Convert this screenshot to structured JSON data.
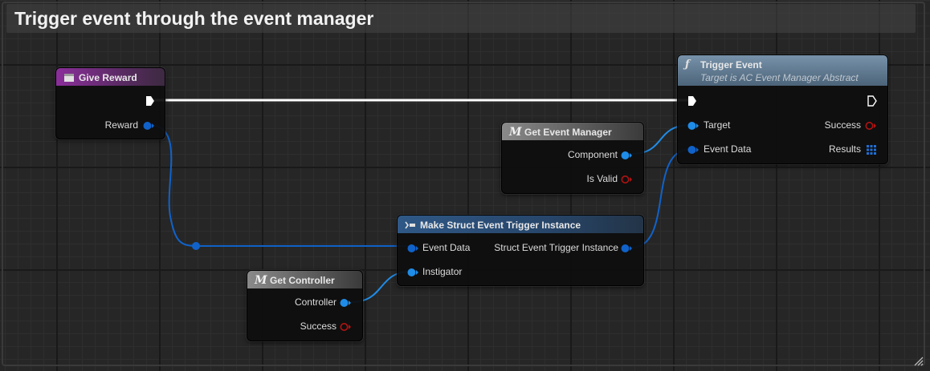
{
  "comment": {
    "title": "Trigger event through the event manager"
  },
  "colors": {
    "exec_wire": "#ffffff",
    "object_pin": "#1f8ce8",
    "struct_pin": "#1062c9",
    "bool_pin": "#b31313",
    "event_header": "#8a2f9a",
    "function_header": "#6d8aa3",
    "macro_header": "#7a7a7a",
    "struct_header": "#2a4f78"
  },
  "nodes": {
    "give_reward": {
      "title": "Give Reward",
      "icon": "event-icon",
      "pins": {
        "reward": "Reward"
      }
    },
    "trigger_event": {
      "title": "Trigger Event",
      "subtitle": "Target is AC Event Manager Abstract",
      "icon": "function-icon",
      "pins": {
        "target": "Target",
        "event_data": "Event Data",
        "success": "Success",
        "results": "Results"
      }
    },
    "get_event_manager": {
      "title": "Get Event Manager",
      "icon": "macro-icon",
      "pins": {
        "component": "Component",
        "is_valid": "Is Valid"
      }
    },
    "make_struct": {
      "title": "Make Struct Event Trigger Instance",
      "icon": "make-struct-icon",
      "pins": {
        "event_data": "Event Data",
        "instigator": "Instigator",
        "output": "Struct Event Trigger Instance"
      }
    },
    "get_controller": {
      "title": "Get Controller",
      "icon": "macro-icon",
      "pins": {
        "controller": "Controller",
        "success": "Success"
      }
    }
  }
}
